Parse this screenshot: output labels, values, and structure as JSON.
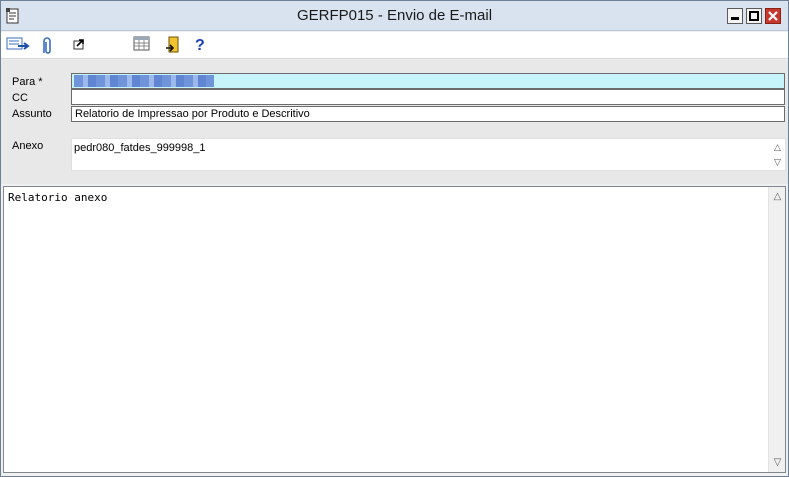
{
  "window": {
    "title": "GERFP015 - Envio de E-mail"
  },
  "toolbar": {
    "buttons": [
      {
        "name": "send-email-button",
        "icon": "send-mail-icon"
      },
      {
        "name": "attach-button",
        "icon": "paperclip-icon"
      },
      {
        "name": "open-link-button",
        "icon": "arrow-out-icon"
      },
      {
        "name": "calendar-button",
        "icon": "calendar-grid-icon"
      },
      {
        "name": "exit-button",
        "icon": "exit-door-icon"
      },
      {
        "name": "help-button",
        "icon": "question-mark-icon",
        "glyph": "?"
      }
    ]
  },
  "form": {
    "para_label": "Para *",
    "cc_label": "CC",
    "assunto_label": "Assunto",
    "assunto_value": "Relatorio de Impressao por Produto e Descritivo",
    "anexo_label": "Anexo",
    "anexo_value": "pedr080_fatdes_999998_1‹"
  },
  "body": {
    "text": "Relatorio anexo"
  },
  "colors": {
    "titlebar": "#d8e3ef",
    "para_field": "#c7f3fb",
    "close_button": "#c7372c",
    "form_background": "#e8e8e8"
  }
}
